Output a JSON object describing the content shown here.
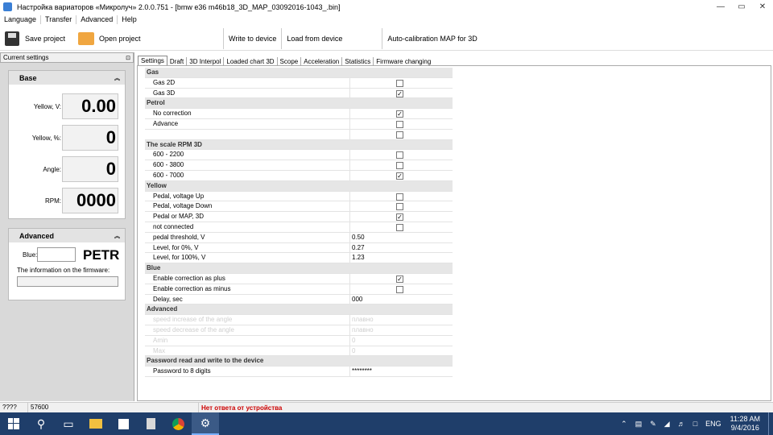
{
  "window": {
    "title": "Настройка вариаторов «Микролуч» 2.0.0.751 - [bmw e36 m46b18_3D_MAP_03092016-1043_.bin]",
    "controls": [
      "—",
      "▭",
      "✕"
    ]
  },
  "menu": [
    "Language",
    "Transfer",
    "Advanced",
    "Help"
  ],
  "toolbar": {
    "save_label": "Save project",
    "open_label": "Open project",
    "write_label": "Write to device",
    "load_label": "Load from device",
    "autocal_label": "Auto-calibration MAP for 3D"
  },
  "sidebar": {
    "header": "Current settings",
    "pin": "⊡",
    "base": {
      "title": "Base",
      "collapse": "︽",
      "fields": [
        {
          "label": "Yellow, V:",
          "value": "0.00"
        },
        {
          "label": "Yellow, %:",
          "value": "0"
        },
        {
          "label": "Angle:",
          "value": "0"
        },
        {
          "label": "RPM:",
          "value": "0000"
        }
      ]
    },
    "advanced": {
      "title": "Advanced",
      "collapse": "︽",
      "blue_label": "Blue:",
      "firmware_name": "PETR",
      "firmware_label": "The information on the firmware:"
    }
  },
  "tabs": [
    "Settings",
    "Draft",
    "3D Interpol",
    "Loaded chart 3D",
    "Scope",
    "Acceleration",
    "Statistics",
    "Firmware changing"
  ],
  "settings_grid": [
    {
      "cat": "Gas"
    },
    {
      "name": "Gas 2D",
      "check": false
    },
    {
      "name": "Gas 3D",
      "check": true
    },
    {
      "cat": "Petrol"
    },
    {
      "name": "No correction",
      "check": true
    },
    {
      "name": "Advance",
      "check": false
    },
    {
      "name": "",
      "check": false
    },
    {
      "cat": "The scale RPM 3D"
    },
    {
      "name": "600 - 2200",
      "check": false
    },
    {
      "name": "600 - 3800",
      "check": false
    },
    {
      "name": "600 - 7000",
      "check": true
    },
    {
      "cat": "Yellow"
    },
    {
      "name": "Pedal, voltage Up",
      "check": false
    },
    {
      "name": "Pedal, voltage Down",
      "check": false
    },
    {
      "name": "Pedal or MAP, 3D",
      "check": true
    },
    {
      "name": "not connected",
      "check": false
    },
    {
      "name": "pedal threshold, V",
      "value": "0.50"
    },
    {
      "name": "Level, for 0%, V",
      "value": "0.27"
    },
    {
      "name": "Level, for 100%, V",
      "value": "1.23"
    },
    {
      "cat": "Blue"
    },
    {
      "name": "Enable correction as plus",
      "check": true
    },
    {
      "name": "Enable correction as minus",
      "check": false
    },
    {
      "name": "Delay, sec",
      "value": "000"
    },
    {
      "cat": "Advanced"
    },
    {
      "name": "speed increase of the angle",
      "value": "плавно",
      "dim": true
    },
    {
      "name": "speed decrease of the angle",
      "value": "плавно",
      "dim": true
    },
    {
      "name": "Amin",
      "value": "0",
      "dim": true
    },
    {
      "name": "Max",
      "value": "0",
      "dim": true
    },
    {
      "cat": "Password read and write to the device"
    },
    {
      "name": "Password to 8 digits",
      "value": "********"
    }
  ],
  "status": {
    "cell1": "????",
    "cell2": "57600",
    "message": "Нет ответа от устройства"
  },
  "taskbar": {
    "lang": "ENG",
    "time": "11:28 AM",
    "date": "9/4/2016"
  },
  "colors": {
    "taskbar": "#1f3e6a",
    "error_text": "#cc0000",
    "sidebar_bg": "#d9d9d9"
  }
}
